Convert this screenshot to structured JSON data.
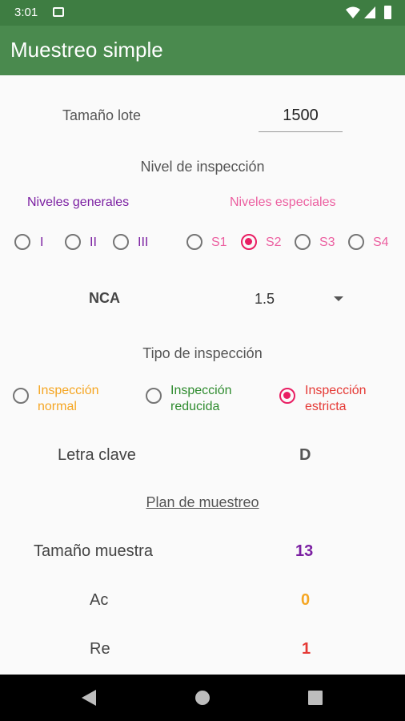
{
  "status": {
    "time": "3:01"
  },
  "app": {
    "title": "Muestreo simple"
  },
  "lot": {
    "label": "Tamaño lote",
    "value": "1500"
  },
  "inspection_level": {
    "title": "Nivel de inspección",
    "general_title": "Niveles generales",
    "special_title": "Niveles especiales",
    "general": [
      "I",
      "II",
      "III"
    ],
    "special": [
      "S1",
      "S2",
      "S3",
      "S4"
    ],
    "selected": "S2"
  },
  "nca": {
    "label": "NCA",
    "value": "1.5"
  },
  "inspection_type": {
    "title": "Tipo de inspección",
    "options": [
      {
        "line1": "Inspección",
        "line2": "normal",
        "color": "#f5a623"
      },
      {
        "line1": "Inspección",
        "line2": "reducida",
        "color": "#2e8b2e"
      },
      {
        "line1": "Inspección",
        "line2": "estricta",
        "color": "#e53935"
      }
    ],
    "selected": 2
  },
  "key_letter": {
    "label": "Letra clave",
    "value": "D"
  },
  "plan": {
    "title": "Plan de muestreo",
    "sample_label": "Tamaño muestra",
    "sample_value": "13",
    "ac_label": "Ac",
    "ac_value": "0",
    "re_label": "Re",
    "re_value": "1"
  },
  "colors": {
    "appbar": "#4a8a4e",
    "statusbar": "#3e7d42",
    "general": "#7b1fa2",
    "special": "#ec5fa0",
    "accent": "#e91e63",
    "ac": "#f5a623",
    "re": "#e53935",
    "sample": "#7b1fa2"
  }
}
